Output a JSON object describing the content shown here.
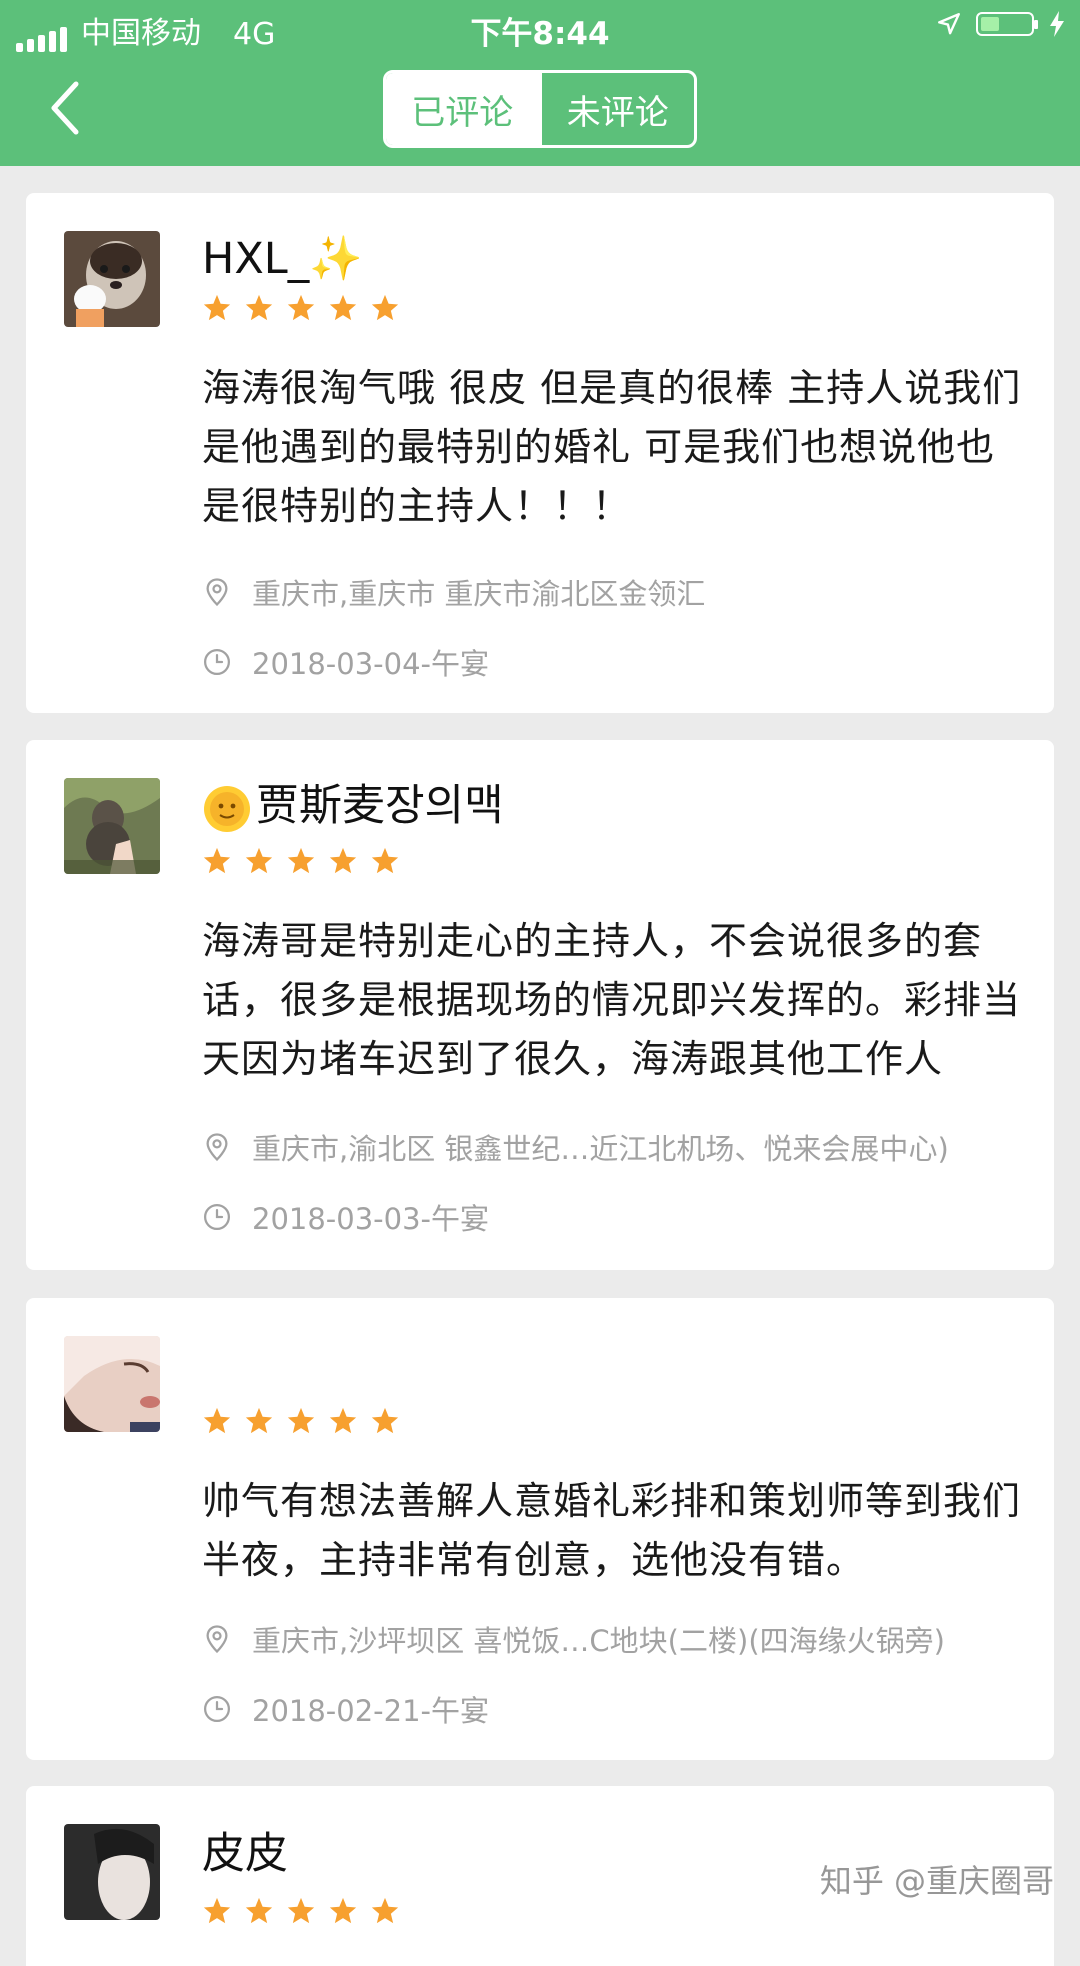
{
  "status_bar": {
    "carrier": "中国移动",
    "network": "4G",
    "time": "下午8:44"
  },
  "header": {
    "tabs": [
      {
        "label": "已评论",
        "active": true
      },
      {
        "label": "未评论",
        "active": false
      }
    ]
  },
  "reviews": [
    {
      "name": "HXL_✨",
      "rating": 5,
      "comment": "海涛很淘气哦 很皮 但是真的很棒 主持人说我们是他遇到的最特别的婚礼 可是我们也想说他也是很特别的主持人！！！",
      "location": "重庆市,重庆市 重庆市渝北区金领汇",
      "date": "2018-03-04-午宴"
    },
    {
      "name_emoji": "🌞",
      "name": "贾斯麦장의맥",
      "rating": 5,
      "comment": "海涛哥是特别走心的主持人，不会说很多的套话，很多是根据现场的情况即兴发挥的。彩排当天因为堵车迟到了很久，海涛跟其他工作人",
      "location": "重庆市,渝北区 银鑫世纪…近江北机场、悦来会展中心)",
      "date": "2018-03-03-午宴"
    },
    {
      "name": "",
      "rating": 5,
      "comment": "帅气有想法善解人意婚礼彩排和策划师等到我们半夜，主持非常有创意，选他没有错。",
      "location": "重庆市,沙坪坝区 喜悦饭…C地块(二楼)(四海缘火锅旁)",
      "date": "2018-02-21-午宴"
    },
    {
      "name": "皮皮",
      "rating": 5
    }
  ],
  "watermark": "知乎 @重庆圈哥",
  "colors": {
    "brand_green": "#5cc07a",
    "star_orange": "#f7a02f",
    "meta_gray": "#a2a2a2"
  },
  "icons": {
    "location": "location-pin-icon",
    "time": "clock-icon",
    "back": "back-chevron-icon"
  }
}
